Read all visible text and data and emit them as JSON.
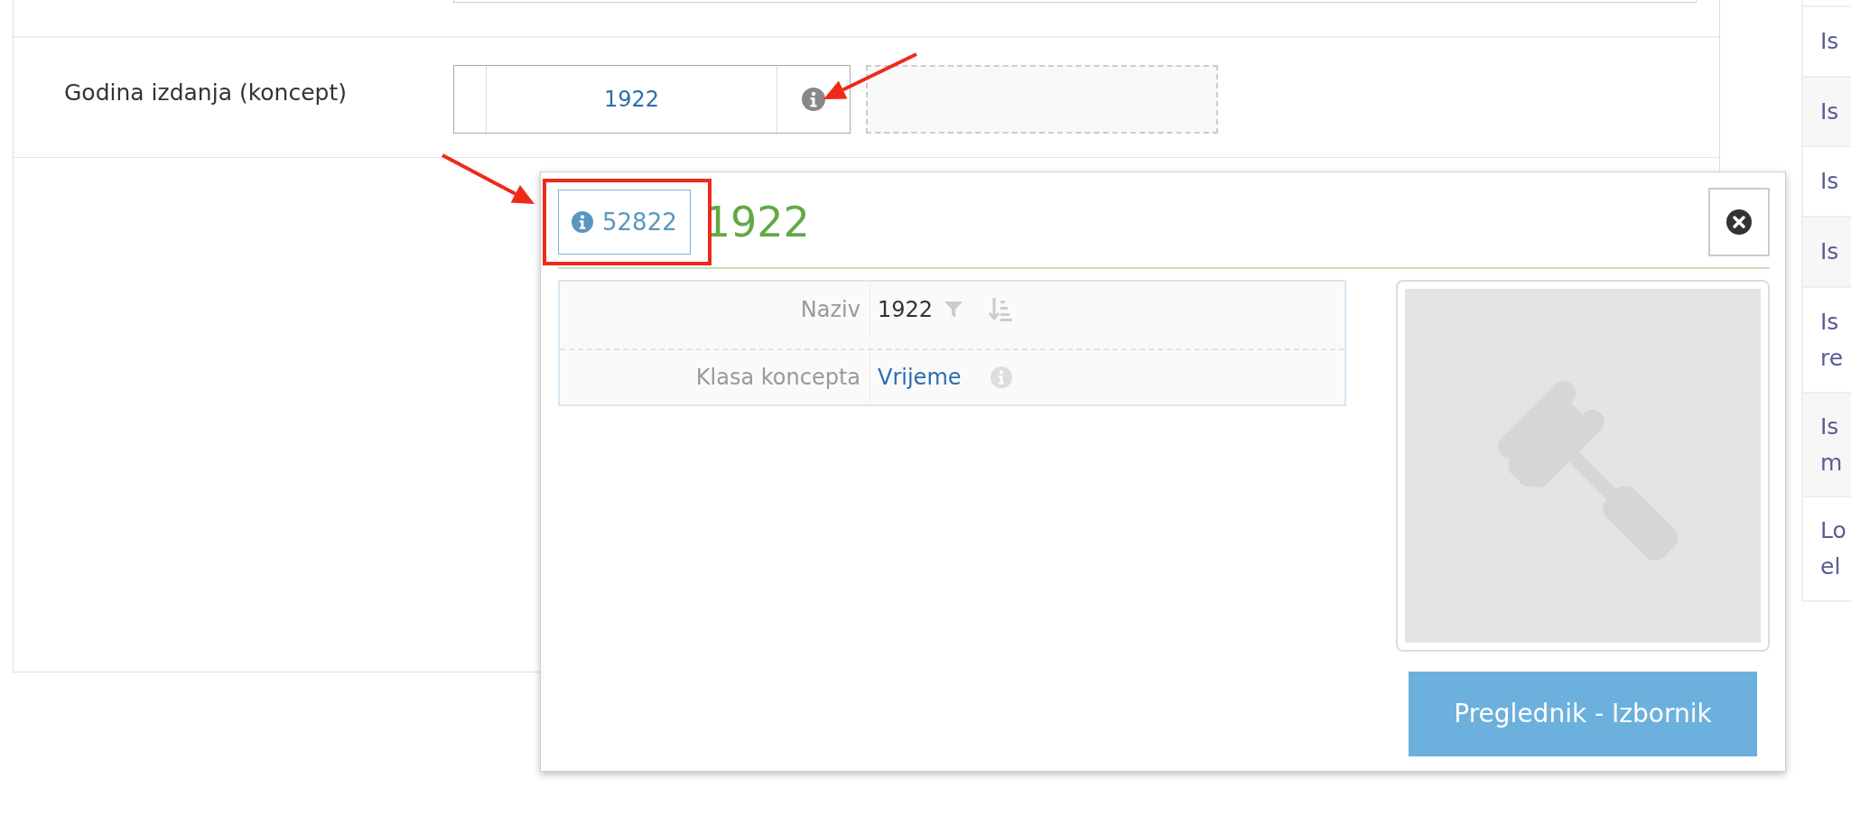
{
  "form_row": {
    "label": "Godina izdanja (koncept)",
    "value": "1922",
    "info_marked": true
  },
  "popup": {
    "id": "52822",
    "id_highlighted": true,
    "title": "1922",
    "properties": [
      {
        "label": "Naziv",
        "value": "1922",
        "kind": "text"
      },
      {
        "label": "Klasa koncepta",
        "value": "Vrijeme",
        "kind": "link"
      }
    ],
    "button": "Preglednik - Izbornik"
  },
  "side_list": [
    {
      "lines": [
        "Is"
      ]
    },
    {
      "lines": [
        "Is"
      ]
    },
    {
      "lines": [
        "Is"
      ]
    },
    {
      "lines": [
        "Is"
      ]
    },
    {
      "lines": [
        "Is",
        "re"
      ]
    },
    {
      "lines": [
        "Is",
        "m"
      ]
    },
    {
      "lines": [
        "Lo",
        "el"
      ]
    }
  ]
}
